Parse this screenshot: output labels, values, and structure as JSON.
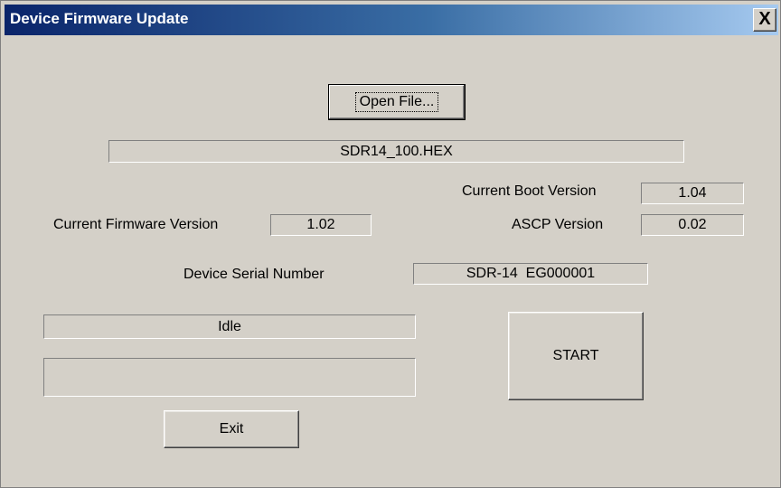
{
  "window": {
    "title": "Device Firmware Update",
    "close_glyph": "X"
  },
  "buttons": {
    "open_file": "Open File...",
    "start": "START",
    "exit": "Exit"
  },
  "file": {
    "name": "SDR14_100.HEX"
  },
  "versions": {
    "boot_label": "Current Boot Version",
    "boot_value": "1.04",
    "firmware_label": "Current Firmware Version",
    "firmware_value": "1.02",
    "ascp_label": "ASCP Version",
    "ascp_value": "0.02"
  },
  "device": {
    "serial_label": "Device Serial Number",
    "serial_value": "SDR-14  EG000001"
  },
  "status": {
    "text": "Idle",
    "progress_text": ""
  }
}
